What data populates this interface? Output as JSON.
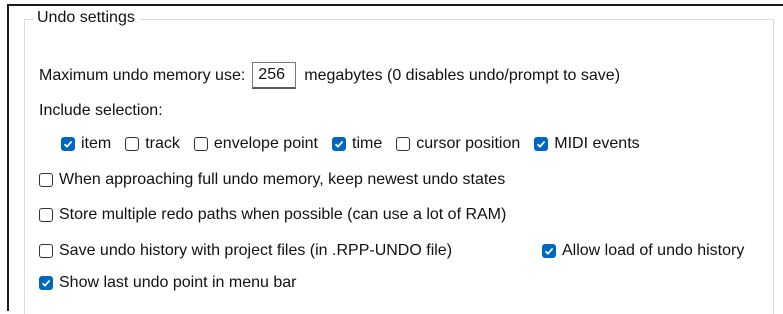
{
  "group_title": "Undo settings",
  "memory": {
    "label": "Maximum undo memory use:",
    "value": "256",
    "suffix": "megabytes (0 disables undo/prompt to save)"
  },
  "include_selection": {
    "label": "Include selection:",
    "options": [
      {
        "label": "item",
        "checked": true
      },
      {
        "label": "track",
        "checked": false
      },
      {
        "label": "envelope point",
        "checked": false
      },
      {
        "label": "time",
        "checked": true
      },
      {
        "label": "cursor position",
        "checked": false
      },
      {
        "label": "MIDI events",
        "checked": true
      }
    ]
  },
  "options": {
    "keep_newest": {
      "label": "When approaching full undo memory, keep newest undo states",
      "checked": false
    },
    "redo_paths": {
      "label": "Store multiple redo paths when possible (can use a lot of RAM)",
      "checked": false
    },
    "save_history": {
      "label": "Save undo history with project files (in .RPP-UNDO file)",
      "checked": false
    },
    "allow_load": {
      "label": "Allow load of undo history",
      "checked": true
    },
    "show_last": {
      "label": "Show last undo point in menu bar",
      "checked": true
    }
  },
  "accent_color": "#0067c0"
}
